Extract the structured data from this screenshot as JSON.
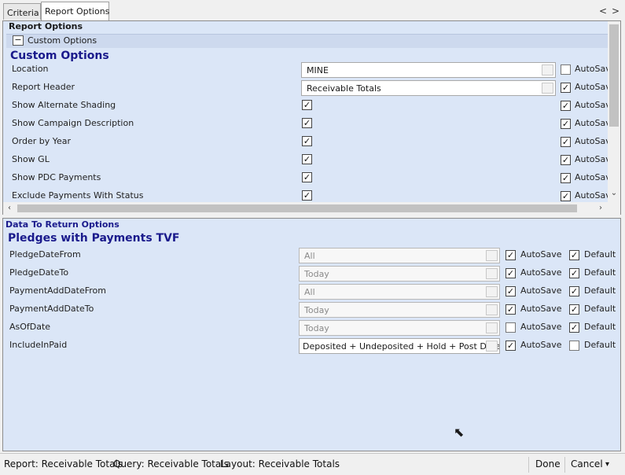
{
  "tabs": [
    "Criteria",
    "Report Options"
  ],
  "nav": {
    "prev": "<",
    "next": ">"
  },
  "report_options": {
    "title": "Report Options",
    "group_toggle": "−",
    "group_label": "Custom Options",
    "section_title": "Custom Options",
    "rows": [
      {
        "label": "Location",
        "value": "MINE",
        "checked": null,
        "autosave": false,
        "autosave_label": "AutoSave"
      },
      {
        "label": "Report Header",
        "value": "Receivable Totals",
        "checked": null,
        "autosave": true,
        "autosave_label": "AutoSave"
      },
      {
        "label": "Show Alternate Shading",
        "checked": true,
        "autosave": true,
        "autosave_label": "AutoSave"
      },
      {
        "label": "Show Campaign Description",
        "checked": true,
        "autosave": true,
        "autosave_label": "AutoSave"
      },
      {
        "label": "Order by Year",
        "checked": true,
        "autosave": true,
        "autosave_label": "AutoSave"
      },
      {
        "label": "Show GL",
        "checked": true,
        "autosave": true,
        "autosave_label": "AutoSave"
      },
      {
        "label": "Show PDC Payments",
        "checked": true,
        "autosave": true,
        "autosave_label": "AutoSave"
      },
      {
        "label": "Exclude Payments With Status",
        "checked": true,
        "autosave": true,
        "autosave_label": "AutoSave"
      }
    ]
  },
  "data_to_return": {
    "title": "Data To Return Options",
    "section_title": "Pledges with Payments TVF",
    "rows": [
      {
        "label": "PledgeDateFrom",
        "value": "All",
        "autosave": true,
        "default": true
      },
      {
        "label": "PledgeDateTo",
        "value": "Today",
        "autosave": true,
        "default": true
      },
      {
        "label": "PaymentAddDateFrom",
        "value": "All",
        "autosave": true,
        "default": true
      },
      {
        "label": "PaymentAddDateTo",
        "value": "Today",
        "autosave": true,
        "default": true
      },
      {
        "label": "AsOfDate",
        "value": "Today",
        "autosave": false,
        "default": true
      },
      {
        "label": "IncludeInPaid",
        "value": "Deposited + Undeposited + Hold + Post Dated -",
        "autosave": true,
        "default": false
      }
    ],
    "autosave_label": "AutoSave",
    "default_label": "Default"
  },
  "status": {
    "report": "Report: Receivable Totals",
    "query": "Query: Receivable Totals",
    "layout": "Layout: Receivable Totals",
    "done": "Done",
    "cancel": "Cancel",
    "cancel_arrow": "▾"
  },
  "colors": {
    "section_title": "#1a1a8c",
    "panel_bg": "#dbe6f7"
  }
}
